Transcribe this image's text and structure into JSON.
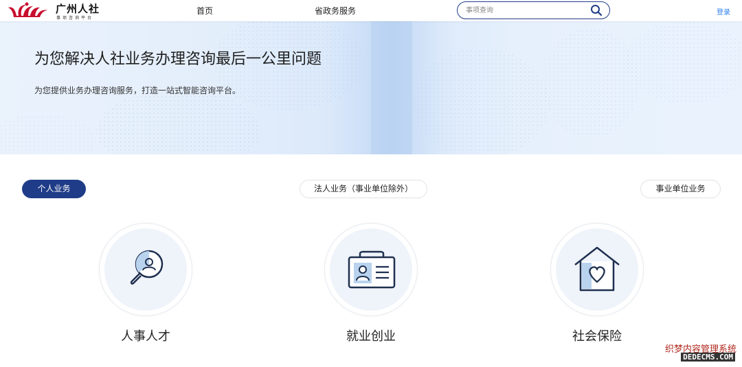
{
  "header": {
    "logo_title": "广州人社",
    "logo_sub": "事项咨询平台",
    "nav": [
      "首页",
      "省政务服务"
    ],
    "search_placeholder": "事项查询",
    "login": "登录"
  },
  "banner": {
    "title": "为您解决人社业务办理咨询最后一公里问题",
    "subtitle": "为您提供业务办理咨询服务，打造一站式智能咨询平台。"
  },
  "tabs": [
    "个人业务",
    "法人业务（事业单位除外）",
    "事业单位业务"
  ],
  "active_tab": "个人业务",
  "services": [
    {
      "label": "人事人才",
      "icon": "talent-search-icon"
    },
    {
      "label": "就业创业",
      "icon": "id-card-icon"
    },
    {
      "label": "社会保险",
      "icon": "house-heart-icon"
    }
  ],
  "watermark": {
    "line1": "织梦内容管理系统",
    "line2": "DEDECMS.COM"
  },
  "colors": {
    "primary": "#1f3c88",
    "link": "#2f80ed",
    "logo_red": "#c8102e",
    "icon_light": "#b9d3ee"
  }
}
